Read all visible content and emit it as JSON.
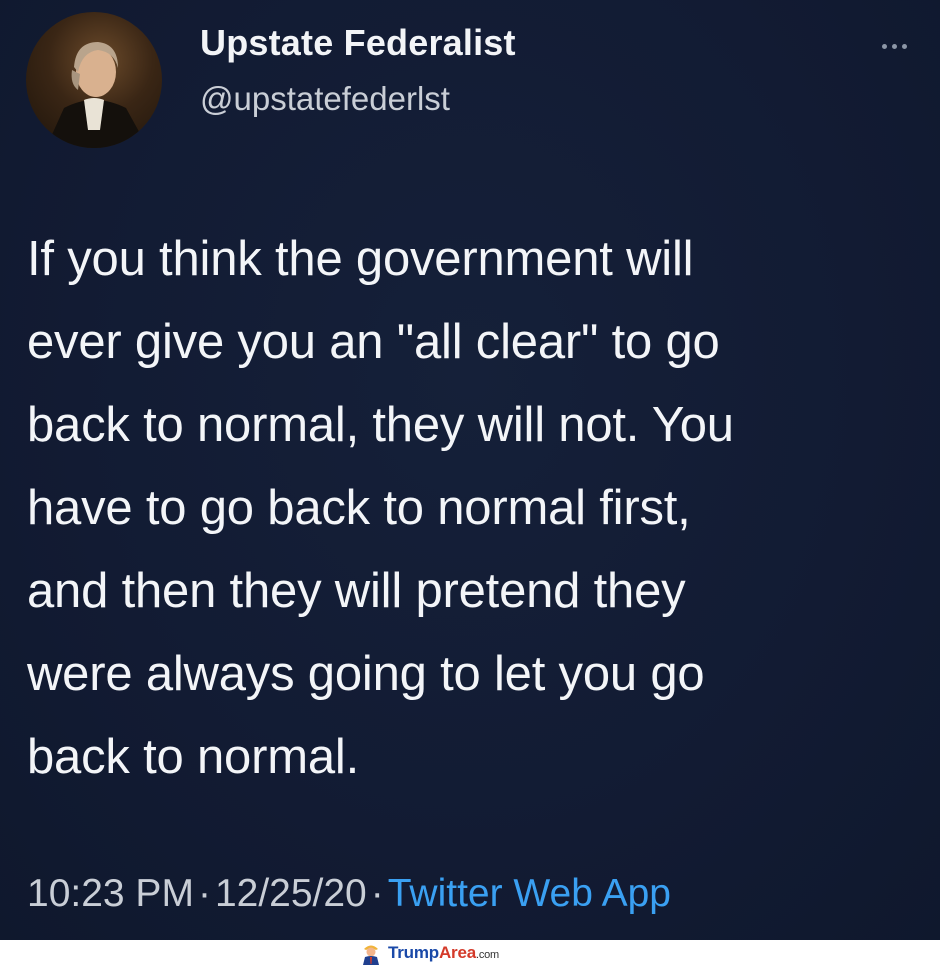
{
  "tweet": {
    "display_name": "Upstate Federalist",
    "handle": "@upstatefederlst",
    "text": "If you think the government will\never give you an \"all clear\" to go\nback to normal, they will not. You\nhave to go back to normal first,\nand then they will pretend they\nwere always going to let you go\nback to normal.",
    "time": "10:23 PM",
    "separator": "·",
    "date": "12/25/20",
    "source": "Twitter Web App",
    "more_icon": "more-horizontal-icon",
    "avatar_icon": "portrait-avatar"
  },
  "watermark": {
    "brand_part1": "Trump",
    "brand_part2": "Area",
    "brand_suffix": ".com",
    "icon": "trump-figure-icon"
  },
  "colors": {
    "background": "#121b33",
    "text": "#f3f5f8",
    "muted": "#c9ced6",
    "link": "#3aa0f2"
  }
}
